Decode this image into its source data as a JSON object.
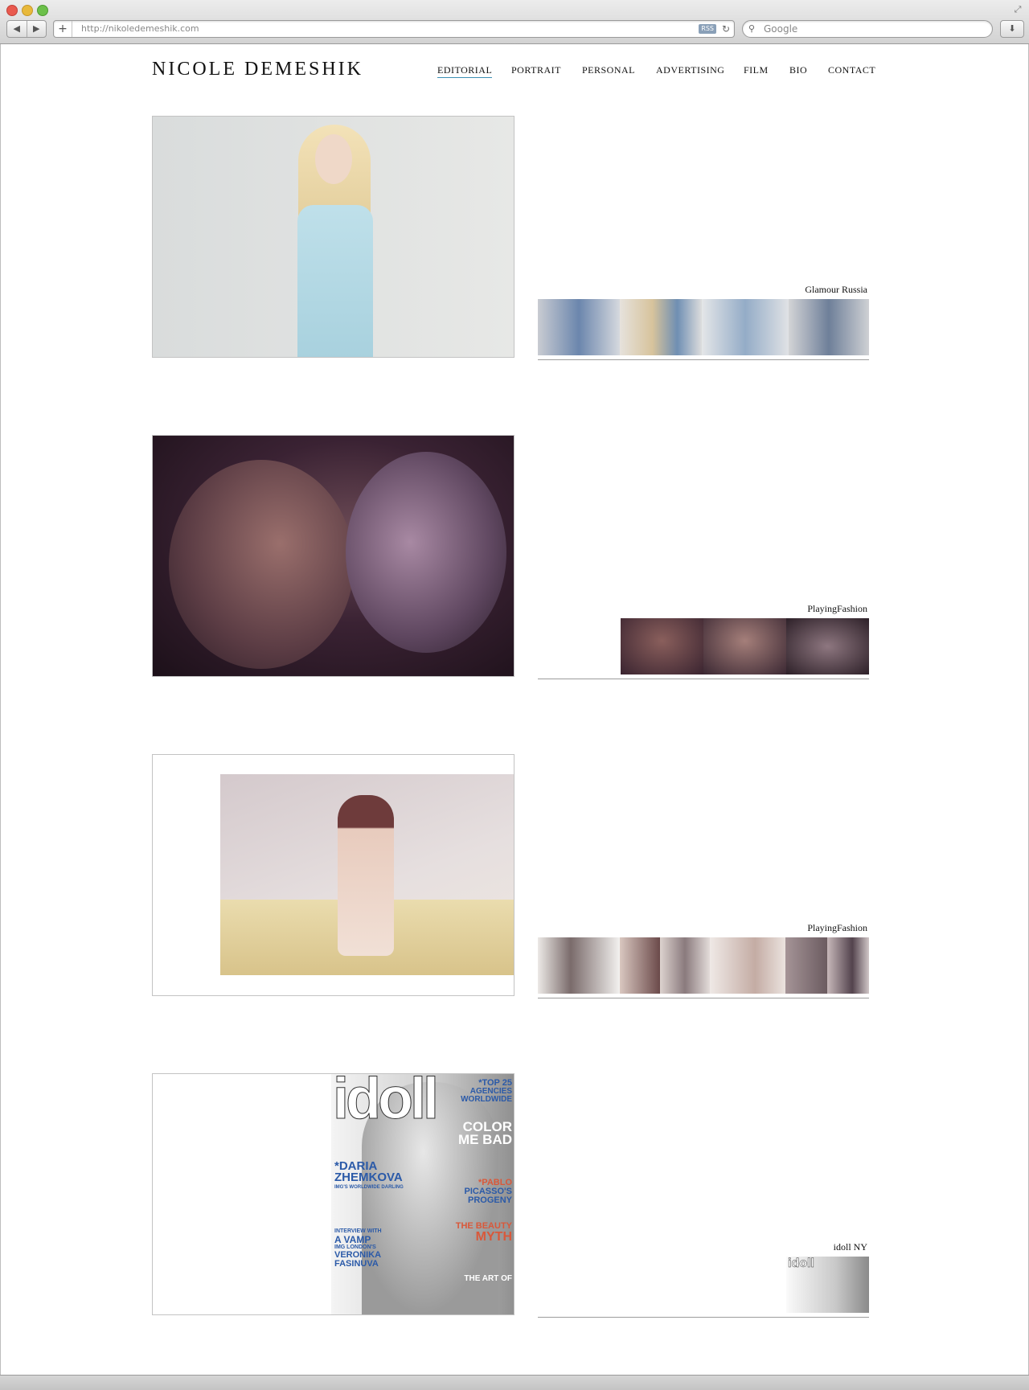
{
  "browser": {
    "url": "http://nikoledemeshik.com",
    "rss_label": "RSS",
    "search_placeholder": "Google",
    "reload_icon": "reload-icon",
    "download_icon": "download-icon"
  },
  "site": {
    "logo": "NICOLE DEMESHIK",
    "nav": [
      "EDITORIAL",
      "PORTRAIT",
      "PERSONAL",
      "ADVERTISING",
      "FILM",
      "BIO",
      "CONTACT"
    ],
    "active_nav": "EDITORIAL",
    "accent_color": "#3b8fb4"
  },
  "entries": [
    {
      "caption": "Glamour Russia",
      "thumb_count": 4
    },
    {
      "caption": "PlayingFashion",
      "thumb_count": 3
    },
    {
      "caption": "PlayingFashion",
      "thumb_count": 6
    },
    {
      "caption": "idoll NY",
      "thumb_count": 1,
      "cover": {
        "masthead": "idoll",
        "left_lines": [
          "*DARIA",
          "ZHEMKOVA",
          "IMG'S WORLDWIDE DARLING",
          "INTERVIEW WITH",
          "A VAMP",
          "IMG LONDON'S",
          "VERONIKA",
          "FASINUVA"
        ],
        "right_lines": [
          "*TOP 25",
          "AGENCIES",
          "WORLDWIDE",
          "COLOR",
          "ME BAD",
          "*PABLO",
          "PICASSO'S",
          "PROGENY",
          "THE BEAUTY",
          "MYTH",
          "THE ART OF"
        ]
      }
    }
  ]
}
